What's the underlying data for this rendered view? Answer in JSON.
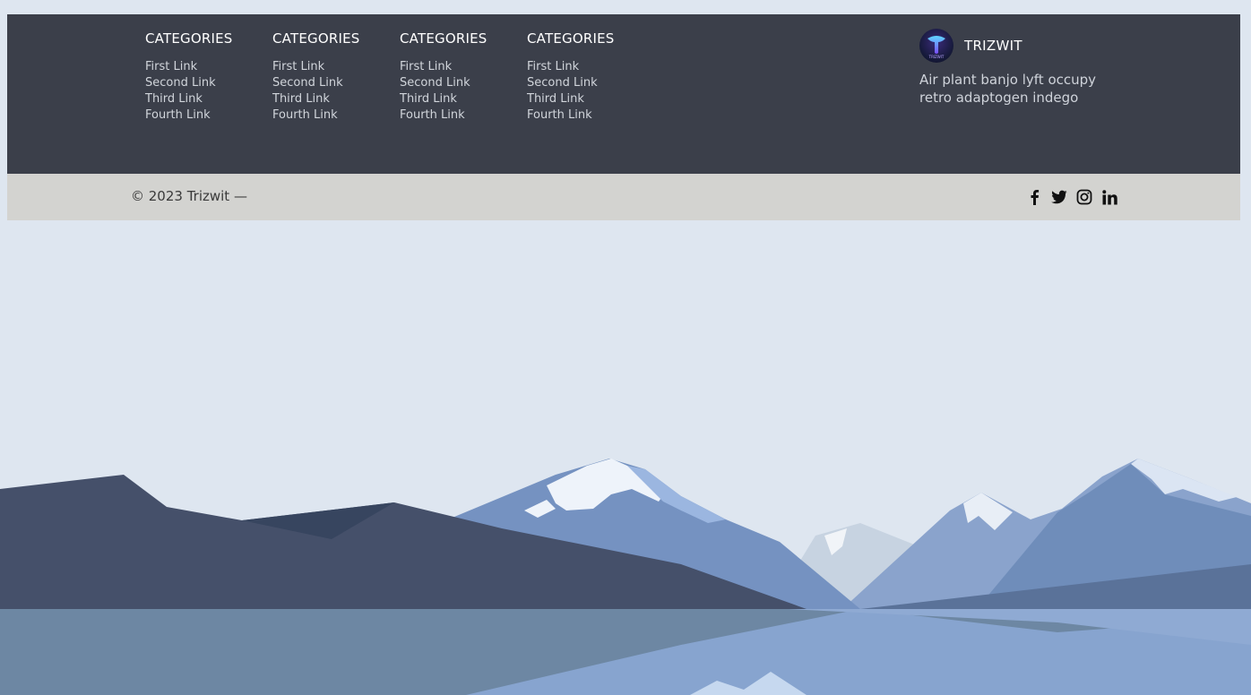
{
  "categories": [
    {
      "title": "CATEGORIES",
      "links": [
        "First Link",
        "Second Link",
        "Third Link",
        "Fourth Link"
      ]
    },
    {
      "title": "CATEGORIES",
      "links": [
        "First Link",
        "Second Link",
        "Third Link",
        "Fourth Link"
      ]
    },
    {
      "title": "CATEGORIES",
      "links": [
        "First Link",
        "Second Link",
        "Third Link",
        "Fourth Link"
      ]
    },
    {
      "title": "CATEGORIES",
      "links": [
        "First Link",
        "Second Link",
        "Third Link",
        "Fourth Link"
      ]
    }
  ],
  "brand": {
    "logo_text": "TRIZWIT",
    "name": "TRIZWIT",
    "description": "Air plant banjo lyft occupy retro adaptogen indego"
  },
  "footer": {
    "copyright": "© 2023 Trizwit —",
    "socials": [
      "facebook-icon",
      "twitter-icon",
      "instagram-icon",
      "linkedin-icon"
    ]
  },
  "colors": {
    "page_background": "#dee6f0",
    "footer_dark": "#3b3f4a",
    "footer_light": "#d3d3d0",
    "mountain_dark": "#45506a",
    "mountain_blue": "#7290bf",
    "water": "#6d87a3"
  }
}
